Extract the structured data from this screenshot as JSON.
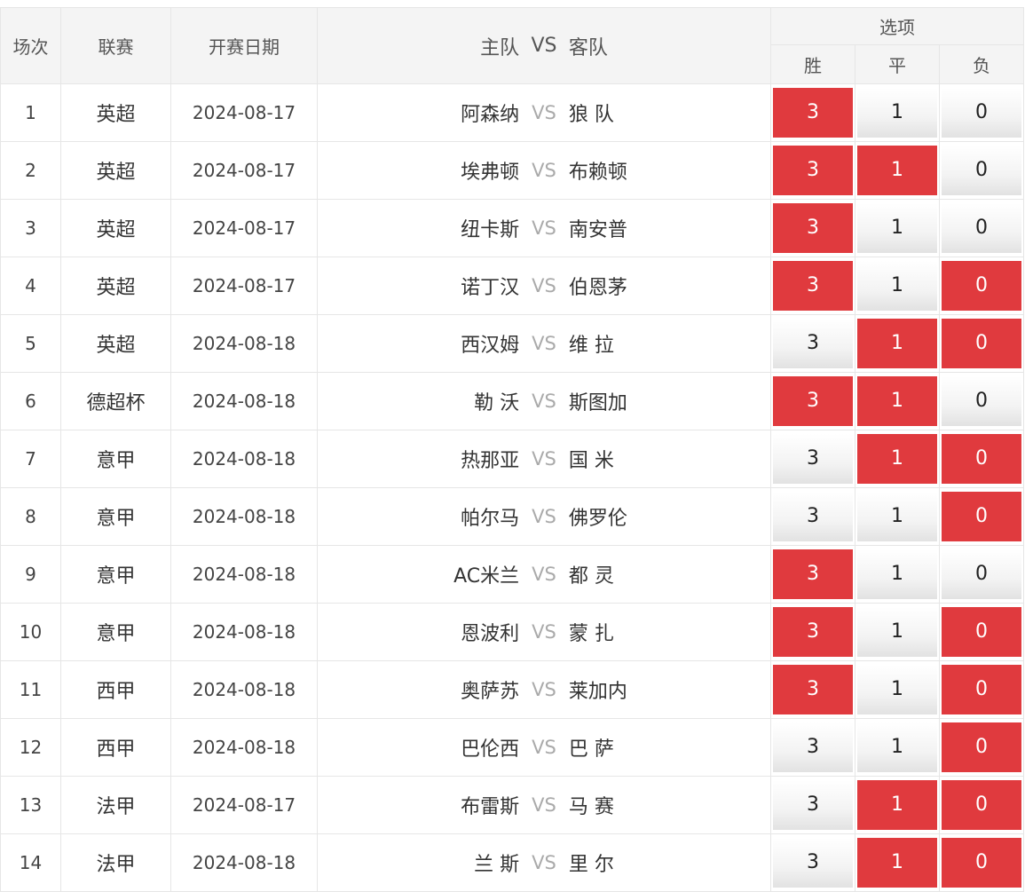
{
  "header": {
    "index": "场次",
    "league": "联赛",
    "date": "开赛日期",
    "home": "主队",
    "vs": "VS",
    "away": "客队",
    "options": "选项",
    "win": "胜",
    "draw": "平",
    "lose": "负"
  },
  "colors": {
    "selected": "#e03a3e",
    "header_bg": "#f4f4f4"
  },
  "rows": [
    {
      "idx": "1",
      "league": "英超",
      "date": "2024-08-17",
      "home": "阿森纳",
      "away": "狼 队",
      "win": "3",
      "draw": "1",
      "lose": "0",
      "sel": [
        true,
        false,
        false
      ]
    },
    {
      "idx": "2",
      "league": "英超",
      "date": "2024-08-17",
      "home": "埃弗顿",
      "away": "布赖顿",
      "win": "3",
      "draw": "1",
      "lose": "0",
      "sel": [
        true,
        true,
        false
      ]
    },
    {
      "idx": "3",
      "league": "英超",
      "date": "2024-08-17",
      "home": "纽卡斯",
      "away": "南安普",
      "win": "3",
      "draw": "1",
      "lose": "0",
      "sel": [
        true,
        false,
        false
      ]
    },
    {
      "idx": "4",
      "league": "英超",
      "date": "2024-08-17",
      "home": "诺丁汉",
      "away": "伯恩茅",
      "win": "3",
      "draw": "1",
      "lose": "0",
      "sel": [
        true,
        false,
        true
      ]
    },
    {
      "idx": "5",
      "league": "英超",
      "date": "2024-08-18",
      "home": "西汉姆",
      "away": "维 拉",
      "win": "3",
      "draw": "1",
      "lose": "0",
      "sel": [
        false,
        true,
        true
      ]
    },
    {
      "idx": "6",
      "league": "德超杯",
      "date": "2024-08-18",
      "home": "勒 沃",
      "away": "斯图加",
      "win": "3",
      "draw": "1",
      "lose": "0",
      "sel": [
        true,
        true,
        false
      ]
    },
    {
      "idx": "7",
      "league": "意甲",
      "date": "2024-08-18",
      "home": "热那亚",
      "away": "国 米",
      "win": "3",
      "draw": "1",
      "lose": "0",
      "sel": [
        false,
        true,
        true
      ]
    },
    {
      "idx": "8",
      "league": "意甲",
      "date": "2024-08-18",
      "home": "帕尔马",
      "away": "佛罗伦",
      "win": "3",
      "draw": "1",
      "lose": "0",
      "sel": [
        false,
        false,
        true
      ]
    },
    {
      "idx": "9",
      "league": "意甲",
      "date": "2024-08-18",
      "home": "AC米兰",
      "away": "都 灵",
      "win": "3",
      "draw": "1",
      "lose": "0",
      "sel": [
        true,
        false,
        false
      ]
    },
    {
      "idx": "10",
      "league": "意甲",
      "date": "2024-08-18",
      "home": "恩波利",
      "away": "蒙 扎",
      "win": "3",
      "draw": "1",
      "lose": "0",
      "sel": [
        true,
        false,
        true
      ]
    },
    {
      "idx": "11",
      "league": "西甲",
      "date": "2024-08-18",
      "home": "奥萨苏",
      "away": "莱加内",
      "win": "3",
      "draw": "1",
      "lose": "0",
      "sel": [
        true,
        false,
        true
      ]
    },
    {
      "idx": "12",
      "league": "西甲",
      "date": "2024-08-18",
      "home": "巴伦西",
      "away": "巴 萨",
      "win": "3",
      "draw": "1",
      "lose": "0",
      "sel": [
        false,
        false,
        true
      ]
    },
    {
      "idx": "13",
      "league": "法甲",
      "date": "2024-08-17",
      "home": "布雷斯",
      "away": "马 赛",
      "win": "3",
      "draw": "1",
      "lose": "0",
      "sel": [
        false,
        true,
        true
      ]
    },
    {
      "idx": "14",
      "league": "法甲",
      "date": "2024-08-18",
      "home": "兰 斯",
      "away": "里 尔",
      "win": "3",
      "draw": "1",
      "lose": "0",
      "sel": [
        false,
        true,
        true
      ]
    }
  ]
}
